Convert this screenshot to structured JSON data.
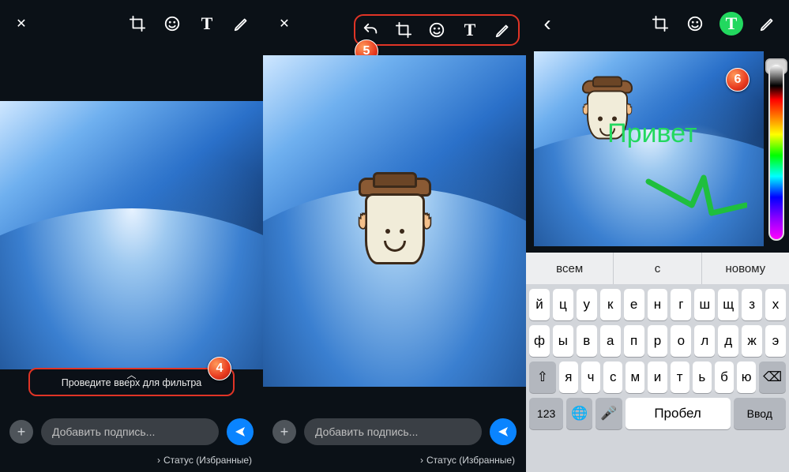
{
  "toolbar": {
    "close": "✕",
    "back": "‹",
    "text_label": "T"
  },
  "hint": {
    "text": "Проведите вверх для фильтра"
  },
  "caption": {
    "placeholder": "Добавить подпись...",
    "add": "+"
  },
  "status": {
    "text": "Статус (Избранные)"
  },
  "badges": {
    "b4": "4",
    "b5": "5",
    "b6": "6"
  },
  "overlay": {
    "greeting": "Привет"
  },
  "suggestions": [
    "всем",
    "с",
    "новому"
  ],
  "kb": {
    "row1": [
      "й",
      "ц",
      "у",
      "к",
      "е",
      "н",
      "г",
      "ш",
      "щ",
      "з",
      "х"
    ],
    "row2": [
      "ф",
      "ы",
      "в",
      "а",
      "п",
      "р",
      "о",
      "л",
      "д",
      "ж",
      "э"
    ],
    "row3_shift": "⇧",
    "row3": [
      "я",
      "ч",
      "с",
      "м",
      "и",
      "т",
      "ь",
      "б",
      "ю"
    ],
    "row3_bksp": "⌫",
    "row4": {
      "num": "123",
      "globe": "🌐",
      "mic": "🎤",
      "space": "Пробел",
      "enter": "Ввод"
    }
  }
}
